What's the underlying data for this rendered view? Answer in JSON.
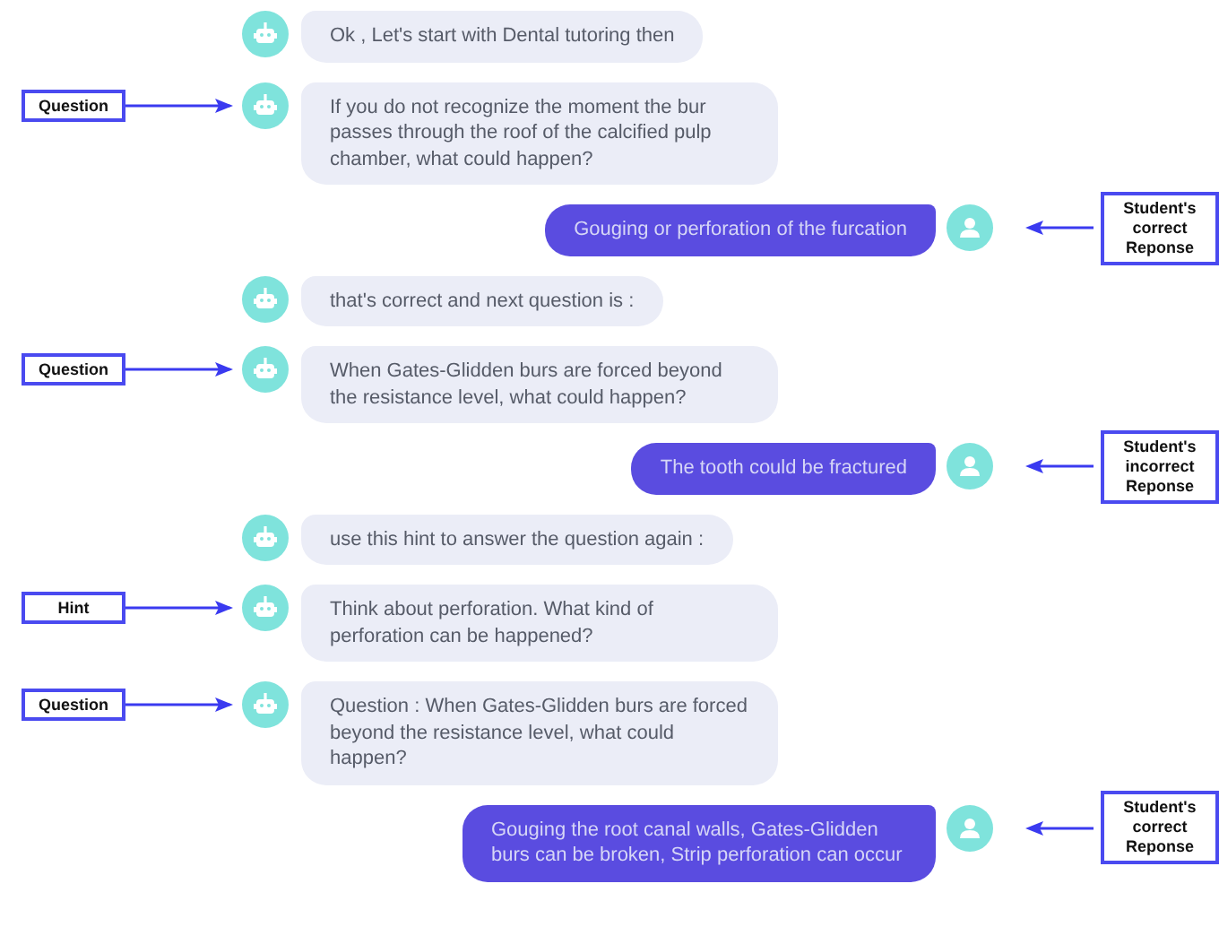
{
  "messages": [
    {
      "kind": "bot",
      "text": "Ok , Let's start with Dental tutoring then"
    },
    {
      "kind": "bot",
      "text": "If you do not recognize the moment the bur passes through the roof of the calcified pulp chamber, what could happen?",
      "annotation": "Question"
    },
    {
      "kind": "user",
      "text": "Gouging or perforation of the furcation",
      "annotation": "Student's correct Reponse"
    },
    {
      "kind": "bot",
      "text": "that's correct and next question is :"
    },
    {
      "kind": "bot",
      "text": "When Gates-Glidden burs are forced beyond the resistance level, what could happen?",
      "annotation": "Question"
    },
    {
      "kind": "user",
      "text": "The tooth could be fractured",
      "annotation": "Student's incorrect Reponse"
    },
    {
      "kind": "bot",
      "text": "use this hint to answer the question again :"
    },
    {
      "kind": "bot",
      "text": "Think about perforation. What kind of perforation can be happened?",
      "annotation": "Hint"
    },
    {
      "kind": "bot",
      "text": "Question : When Gates-Glidden burs are forced beyond the resistance level, what could happen?",
      "annotation": "Question"
    },
    {
      "kind": "user",
      "text": "Gouging the root canal walls, Gates-Glidden burs can be broken, Strip perforation can occur",
      "annotation": "Student's correct Reponse"
    }
  ]
}
